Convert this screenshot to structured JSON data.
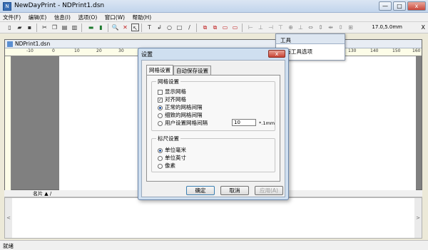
{
  "window": {
    "title": "NewDayPrint - NDPrint1.dsn",
    "min": "—",
    "max": "□",
    "close": "x"
  },
  "menu": [
    "文件(F)",
    "编辑(E)",
    "信息(I)",
    "选项(O)",
    "窗口(W)",
    "帮助(H)"
  ],
  "toolbar": {
    "coord": "17.0,5.0mm",
    "x_label": "X"
  },
  "document": {
    "tab_title": "NDPrint1.dsn",
    "ruler_ticks": [
      "-10",
      "0",
      "10",
      "20",
      "30",
      "40",
      "50",
      "60",
      "70",
      "80",
      "90",
      "100",
      "110",
      "120",
      "130",
      "140",
      "150",
      "160"
    ]
  },
  "tool_panel": {
    "title": "工具",
    "body": "没有工具选项"
  },
  "dialog": {
    "title": "设置",
    "close": "x",
    "tabs": [
      "网格设置",
      "自动保存设置"
    ],
    "grid_group": {
      "label": "网格设置",
      "items": [
        {
          "label": "显示网格",
          "checked": false
        },
        {
          "label": "对齐网格",
          "checked": true
        }
      ],
      "radios": [
        {
          "label": "正常的网格间隔",
          "selected": true
        },
        {
          "label": "细致的网格间隔",
          "selected": false
        },
        {
          "label": "用户设置网格间隔",
          "selected": false
        }
      ],
      "custom_value": "10",
      "custom_unit": "*.1mm"
    },
    "ruler_group": {
      "label": "标尺设置",
      "radios": [
        {
          "label": "单位毫米",
          "selected": true
        },
        {
          "label": "单位英寸",
          "selected": false
        },
        {
          "label": "像素",
          "selected": false
        }
      ]
    },
    "buttons": {
      "ok": "确定",
      "cancel": "取消",
      "apply": "应用(A)"
    }
  },
  "bottom": {
    "tab": "名片 ▲ /"
  },
  "status": "就绪"
}
